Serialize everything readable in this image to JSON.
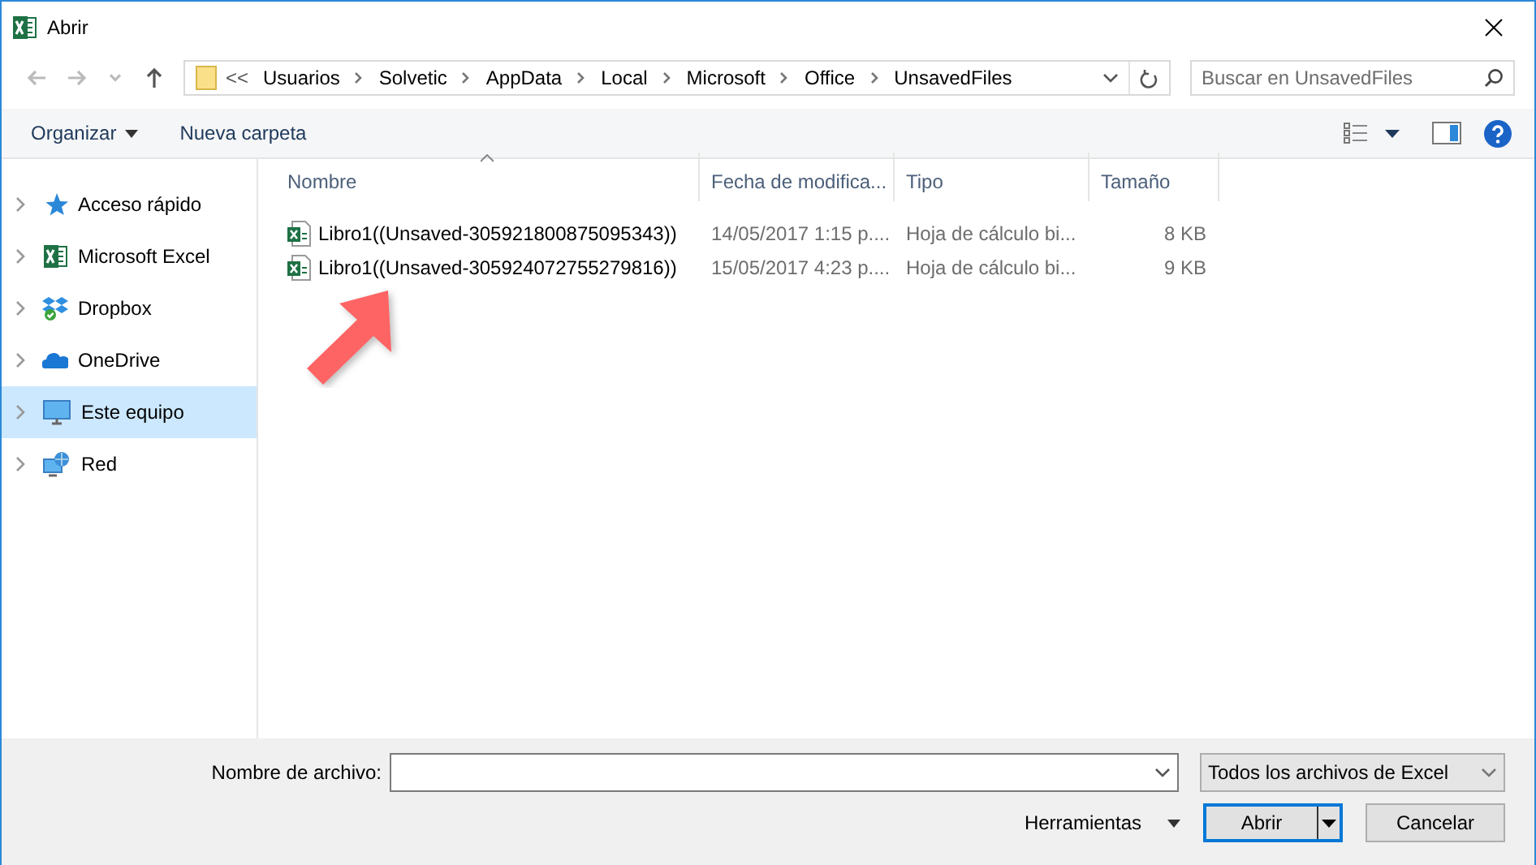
{
  "window": {
    "title": "Abrir"
  },
  "address": {
    "overflow": "<<",
    "segments": [
      "Usuarios",
      "Solvetic",
      "AppData",
      "Local",
      "Microsoft",
      "Office",
      "UnsavedFiles"
    ]
  },
  "search": {
    "placeholder": "Buscar en UnsavedFiles"
  },
  "toolbar": {
    "organize": "Organizar",
    "new_folder": "Nueva carpeta"
  },
  "sidebar": {
    "items": [
      {
        "label": "Acceso rápido",
        "kind": "star",
        "selected": false
      },
      {
        "label": "Microsoft Excel",
        "kind": "excel",
        "selected": false
      },
      {
        "label": "Dropbox",
        "kind": "dropbox",
        "selected": false
      },
      {
        "label": "OneDrive",
        "kind": "cloud",
        "selected": false
      },
      {
        "label": "Este equipo",
        "kind": "computer",
        "selected": true
      },
      {
        "label": "Red",
        "kind": "network",
        "selected": false
      }
    ]
  },
  "table": {
    "columns": [
      {
        "label": "Nombre",
        "sorted": true
      },
      {
        "label": "Fecha de modifica...",
        "sorted": false
      },
      {
        "label": "Tipo",
        "sorted": false
      },
      {
        "label": "Tamaño",
        "sorted": false
      }
    ],
    "rows": [
      {
        "name": "Libro1((Unsaved-305921800875095343))",
        "date": "14/05/2017 1:15 p....",
        "type": "Hoja de cálculo bi...",
        "size": "8 KB"
      },
      {
        "name": "Libro1((Unsaved-305924072755279816))",
        "date": "15/05/2017 4:23 p....",
        "type": "Hoja de cálculo bi...",
        "size": "9 KB"
      }
    ]
  },
  "footer": {
    "file_name_label": "Nombre de archivo:",
    "filter": "Todos los archivos de Excel",
    "tools": "Herramientas",
    "buttons": [
      {
        "label": "Abrir",
        "default": true
      },
      {
        "label": "Cancelar",
        "default": false
      }
    ]
  }
}
